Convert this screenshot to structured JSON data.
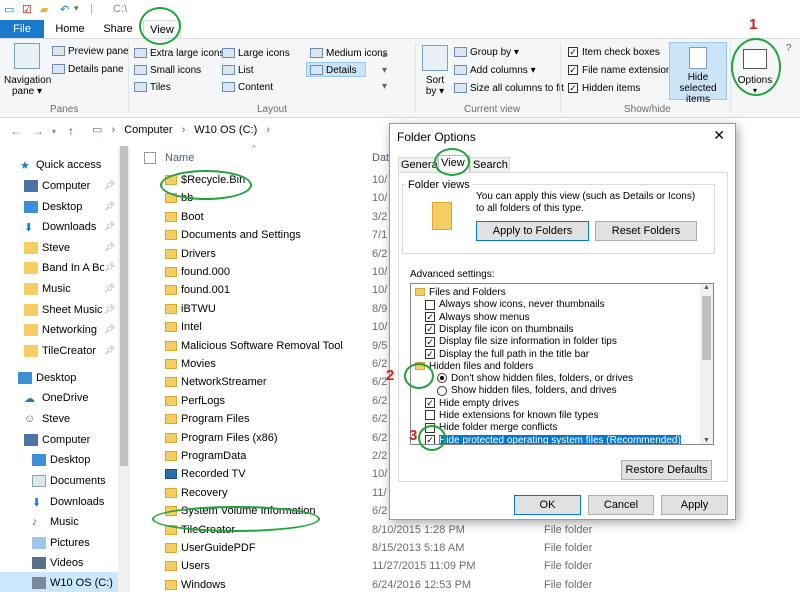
{
  "window": {
    "path_title": "C:\\"
  },
  "tabs": {
    "file": "File",
    "home": "Home",
    "share": "Share",
    "view": "View"
  },
  "ribbon": {
    "panes": {
      "navigation_pane": "Navigation",
      "navigation_pane_2": "pane",
      "preview_pane": "Preview pane",
      "details_pane": "Details pane",
      "group": "Panes"
    },
    "layout": {
      "extra_large": "Extra large icons",
      "large": "Large icons",
      "medium": "Medium icons",
      "small": "Small icons",
      "list": "List",
      "details": "Details",
      "tiles": "Tiles",
      "content": "Content",
      "group": "Layout"
    },
    "current_view": {
      "sort_by": "Sort",
      "sort_by_2": "by",
      "group_by": "Group by",
      "add_columns": "Add columns",
      "size_all": "Size all columns to fit",
      "group": "Current view"
    },
    "show_hide": {
      "item_check_boxes": "Item check boxes",
      "file_name_extensions": "File name extensions",
      "hidden_items": "Hidden items",
      "hide_selected_1": "Hide selected",
      "hide_selected_2": "items",
      "group": "Show/hide"
    },
    "options": "Options"
  },
  "address": {
    "crumbs": [
      "Computer",
      "W10 OS (C:)"
    ]
  },
  "nav_pane": {
    "items": [
      {
        "label": "Quick access"
      },
      {
        "label": "Computer"
      },
      {
        "label": "Desktop"
      },
      {
        "label": "Downloads"
      },
      {
        "label": "Steve"
      },
      {
        "label": "Band In A Box"
      },
      {
        "label": "Music"
      },
      {
        "label": "Sheet Music"
      },
      {
        "label": "Networking"
      },
      {
        "label": "TileCreator"
      },
      {
        "label": "Desktop"
      },
      {
        "label": "OneDrive"
      },
      {
        "label": "Steve"
      },
      {
        "label": "Computer"
      },
      {
        "label": "Desktop"
      },
      {
        "label": "Documents"
      },
      {
        "label": "Downloads"
      },
      {
        "label": "Music"
      },
      {
        "label": "Pictures"
      },
      {
        "label": "Videos"
      },
      {
        "label": "W10 OS (C:)"
      }
    ]
  },
  "file_list": {
    "col_name": "Name",
    "col_date": "Dat",
    "rows": [
      {
        "name": "$Recycle.Bin",
        "date": "10/",
        "type": ""
      },
      {
        "name": "bb",
        "date": "10/",
        "type": ""
      },
      {
        "name": "Boot",
        "date": "3/2",
        "type": ""
      },
      {
        "name": "Documents and Settings",
        "date": "7/1",
        "type": ""
      },
      {
        "name": "Drivers",
        "date": "6/2",
        "type": ""
      },
      {
        "name": "found.000",
        "date": "10/",
        "type": ""
      },
      {
        "name": "found.001",
        "date": "10/",
        "type": ""
      },
      {
        "name": "iBTWU",
        "date": "8/9",
        "type": ""
      },
      {
        "name": "Intel",
        "date": "10/",
        "type": ""
      },
      {
        "name": "Malicious Software Removal Tool",
        "date": "9/5",
        "type": ""
      },
      {
        "name": "Movies",
        "date": "6/2",
        "type": ""
      },
      {
        "name": "NetworkStreamer",
        "date": "6/2",
        "type": ""
      },
      {
        "name": "PerfLogs",
        "date": "6/2",
        "type": ""
      },
      {
        "name": "Program Files",
        "date": "6/2",
        "type": ""
      },
      {
        "name": "Program Files (x86)",
        "date": "6/2",
        "type": ""
      },
      {
        "name": "ProgramData",
        "date": "2/2",
        "type": ""
      },
      {
        "name": "Recorded TV",
        "date": "10/",
        "type": ""
      },
      {
        "name": "Recovery",
        "date": "11/",
        "type": ""
      },
      {
        "name": "System Volume Information",
        "date": "6/2",
        "type": ""
      },
      {
        "name": "TileCreator",
        "date": "8/10/2015 1:28 PM",
        "type": "File folder"
      },
      {
        "name": "UserGuidePDF",
        "date": "8/15/2013 5:18 AM",
        "type": "File folder"
      },
      {
        "name": "Users",
        "date": "11/27/2015 11:09 PM",
        "type": "File folder"
      },
      {
        "name": "Windows",
        "date": "6/24/2016 12:53 PM",
        "type": "File folder"
      }
    ]
  },
  "dialog": {
    "title": "Folder Options",
    "close": "✕",
    "tabs": {
      "general": "General",
      "view": "View",
      "search": "Search"
    },
    "folder_views": "Folder views",
    "folder_views_text": "You can apply this view (such as Details or Icons) to all folders of this type.",
    "apply_to_folders": "Apply to Folders",
    "reset_folders": "Reset Folders",
    "advanced_label": "Advanced settings:",
    "advanced": [
      {
        "kind": "folder",
        "label": "Files and Folders"
      },
      {
        "kind": "check",
        "checked": false,
        "label": "Always show icons, never thumbnails"
      },
      {
        "kind": "check",
        "checked": true,
        "label": "Always show menus"
      },
      {
        "kind": "check",
        "checked": true,
        "label": "Display file icon on thumbnails"
      },
      {
        "kind": "check",
        "checked": true,
        "label": "Display file size information in folder tips"
      },
      {
        "kind": "check",
        "checked": true,
        "label": "Display the full path in the title bar"
      },
      {
        "kind": "folder",
        "label": "Hidden files and folders"
      },
      {
        "kind": "radio",
        "checked": true,
        "label": "Don't show hidden files, folders, or drives"
      },
      {
        "kind": "radio",
        "checked": false,
        "label": "Show hidden files, folders, and drives"
      },
      {
        "kind": "check",
        "checked": true,
        "label": "Hide empty drives"
      },
      {
        "kind": "check",
        "checked": false,
        "label": "Hide extensions for known file types"
      },
      {
        "kind": "check",
        "checked": false,
        "label": "Hide folder merge conflicts"
      },
      {
        "kind": "check",
        "checked": true,
        "label": "Hide protected operating system files (Recommended)",
        "selected": true
      }
    ],
    "restore_defaults": "Restore Defaults",
    "ok": "OK",
    "cancel": "Cancel",
    "apply": "Apply"
  },
  "annotations": {
    "n1": "1",
    "n2": "2",
    "n3": "3"
  },
  "colors": {
    "accent": "#1979ca",
    "annotation_circle": "#20a33a",
    "annotation_number": "#d2201d",
    "selection": "#cce4f7"
  }
}
